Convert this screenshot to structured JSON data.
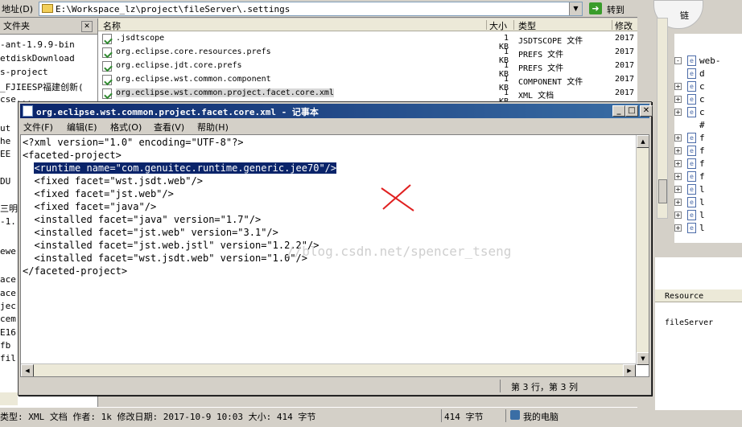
{
  "address_bar": {
    "label": "地址(D)",
    "path": "E:\\Workspace_lz\\project\\fileServer\\.settings",
    "go_label": "转到"
  },
  "folder_pane": {
    "title": "文件夹",
    "items": [
      "-ant-1.9.9-bin",
      "etdiskDownload",
      "s-project",
      "_FJIEESP福建创新(",
      "cse...",
      "ut",
      "he",
      "EE",
      "DU",
      "三明",
      "-1.",
      "ewe",
      "ace",
      "ace",
      "jec",
      "cem",
      "E16",
      "fb",
      "fil"
    ]
  },
  "file_list": {
    "headers": {
      "name": "名称",
      "size": "大小",
      "type": "类型",
      "modified": "修改"
    },
    "rows": [
      {
        "name": ".jsdtscope",
        "size": "1 KB",
        "type": "JSDTSCOPE 文件",
        "modified": "2017"
      },
      {
        "name": "org.eclipse.core.resources.prefs",
        "size": "1 KB",
        "type": "PREFS 文件",
        "modified": "2017"
      },
      {
        "name": "org.eclipse.jdt.core.prefs",
        "size": "1 KB",
        "type": "PREFS 文件",
        "modified": "2017"
      },
      {
        "name": "org.eclipse.wst.common.component",
        "size": "1 KB",
        "type": "COMPONENT 文件",
        "modified": "2017"
      },
      {
        "name": "org.eclipse.wst.common.project.facet.core.xml",
        "size": "1 KB",
        "type": "XML 文档",
        "modified": "2017"
      }
    ]
  },
  "notepad": {
    "title": "org.eclipse.wst.common.project.facet.core.xml - 记事本",
    "menu": [
      "文件(F)",
      "编辑(E)",
      "格式(O)",
      "查看(V)",
      "帮助(H)"
    ],
    "lines": [
      "<?xml version=\"1.0\" encoding=\"UTF-8\"?>",
      "<faceted-project>",
      "  <runtime name=\"com.genuitec.runtime.generic.jee70\"/>",
      "  <fixed facet=\"wst.jsdt.web\"/>",
      "  <fixed facet=\"jst.web\"/>",
      "  <fixed facet=\"java\"/>",
      "  <installed facet=\"java\" version=\"1.7\"/>",
      "  <installed facet=\"jst.web\" version=\"3.1\"/>",
      "  <installed facet=\"jst.web.jstl\" version=\"1.2.2\"/>",
      "  <installed facet=\"wst.jsdt.web\" version=\"1.0\"/>",
      "</faceted-project>"
    ],
    "watermark": "//blog.csdn.net/spencer_tseng",
    "status_position": "第 3 行，第 3 列"
  },
  "status_bar": {
    "info": "类型: XML 文档 作者: 1k 修改日期: 2017-10-9 10:03 大小: 414 字节",
    "size": "414 字节",
    "location": "我的电脑"
  },
  "ide": {
    "tree": [
      {
        "expander": "-",
        "label": "web-"
      },
      {
        "expander": "",
        "label": "d"
      },
      {
        "expander": "+",
        "label": "c"
      },
      {
        "expander": "+",
        "label": "c"
      },
      {
        "expander": "+",
        "label": "c"
      },
      {
        "expander": "",
        "label": "#"
      },
      {
        "expander": "+",
        "label": "f"
      },
      {
        "expander": "+",
        "label": "f"
      },
      {
        "expander": "+",
        "label": "f"
      },
      {
        "expander": "+",
        "label": "f"
      },
      {
        "expander": "+",
        "label": "l"
      },
      {
        "expander": "+",
        "label": "l"
      },
      {
        "expander": "+",
        "label": "l"
      },
      {
        "expander": "+",
        "label": "l"
      }
    ],
    "resource_header": "Resource",
    "resource_value": "fileServer",
    "bubble_text": "链"
  }
}
